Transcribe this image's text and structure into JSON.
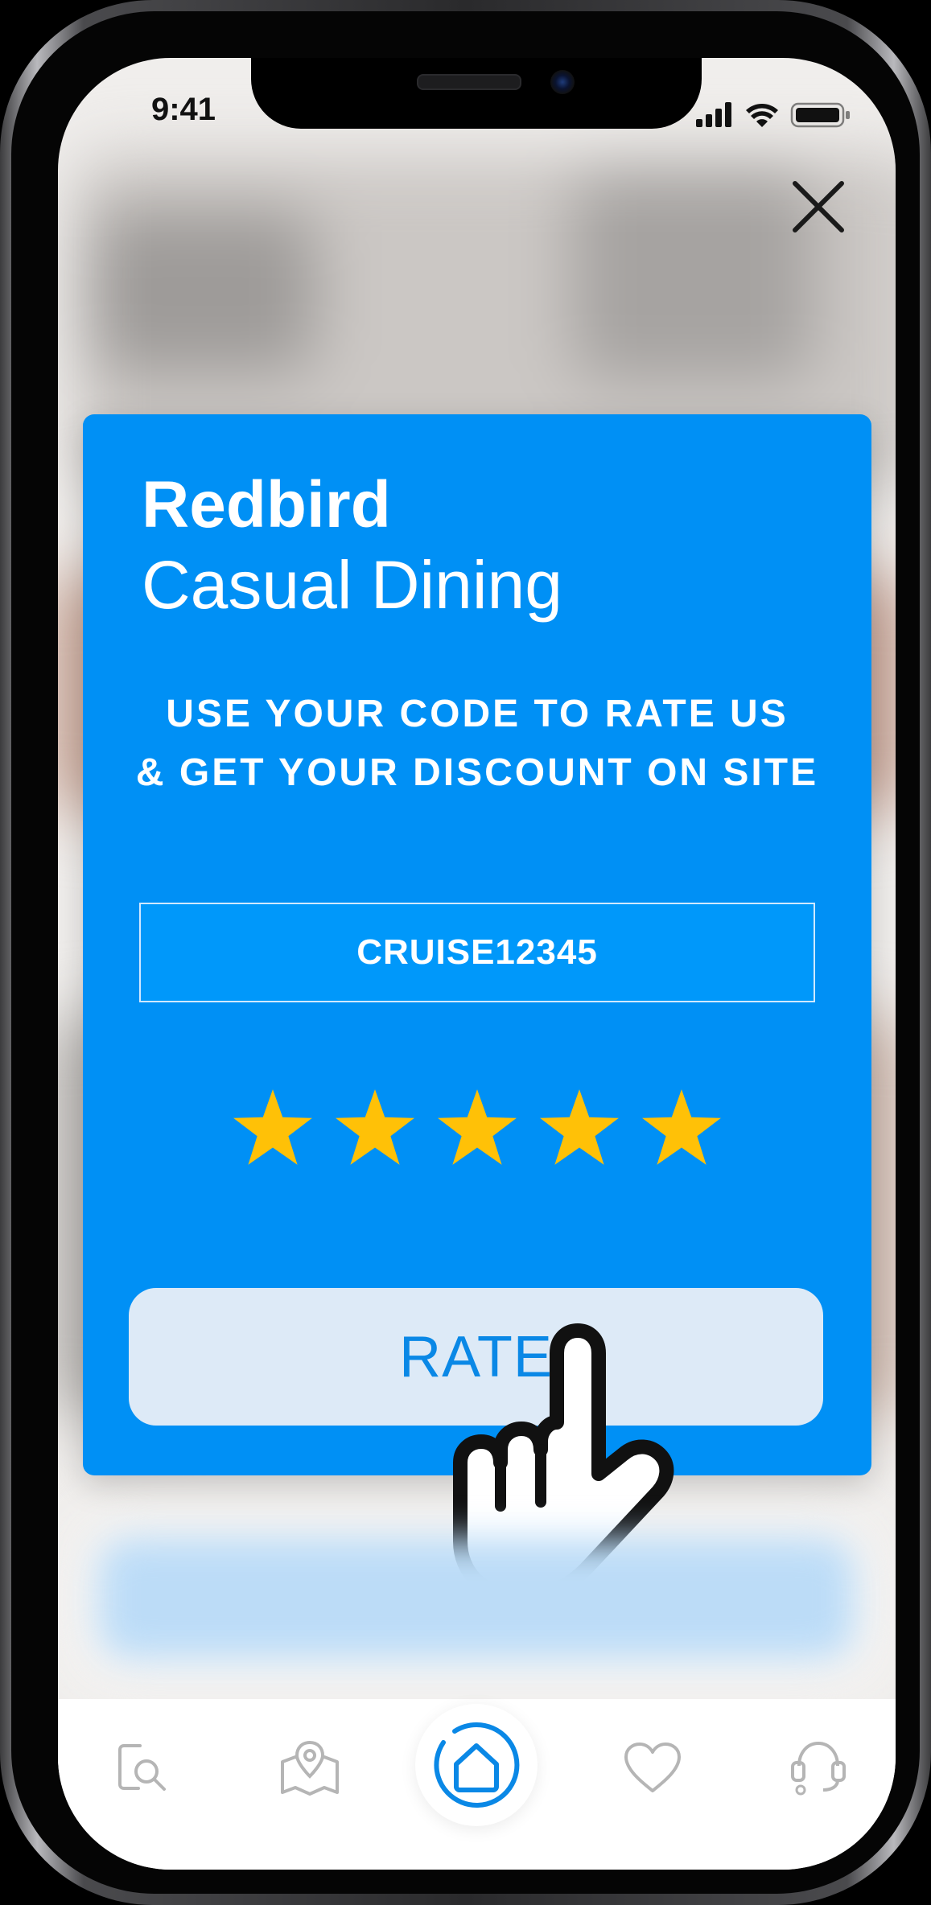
{
  "status_bar": {
    "time": "9:41"
  },
  "card": {
    "title": "Redbird",
    "subtitle": "Casual Dining",
    "instruction_line1": "USE YOUR CODE TO RATE US",
    "instruction_line2": "& GET YOUR DISCOUNT ON SITE",
    "code": "CRUISE12345",
    "rating": {
      "value": 5,
      "max": 5
    },
    "rate_label": "RATE"
  },
  "tabbar": {
    "items": [
      {
        "icon": "search-icon"
      },
      {
        "icon": "map-pin-icon"
      },
      {
        "icon": "home-icon",
        "active": true
      },
      {
        "icon": "heart-icon"
      },
      {
        "icon": "support-icon"
      }
    ]
  },
  "colors": {
    "card_background": "#0090f5",
    "star": "#ffc107",
    "rate_button_background": "#ddeaf7",
    "rate_button_text": "#0a88e6",
    "accent": "#0a88e6",
    "tab_icon": "#b5b5b5"
  }
}
